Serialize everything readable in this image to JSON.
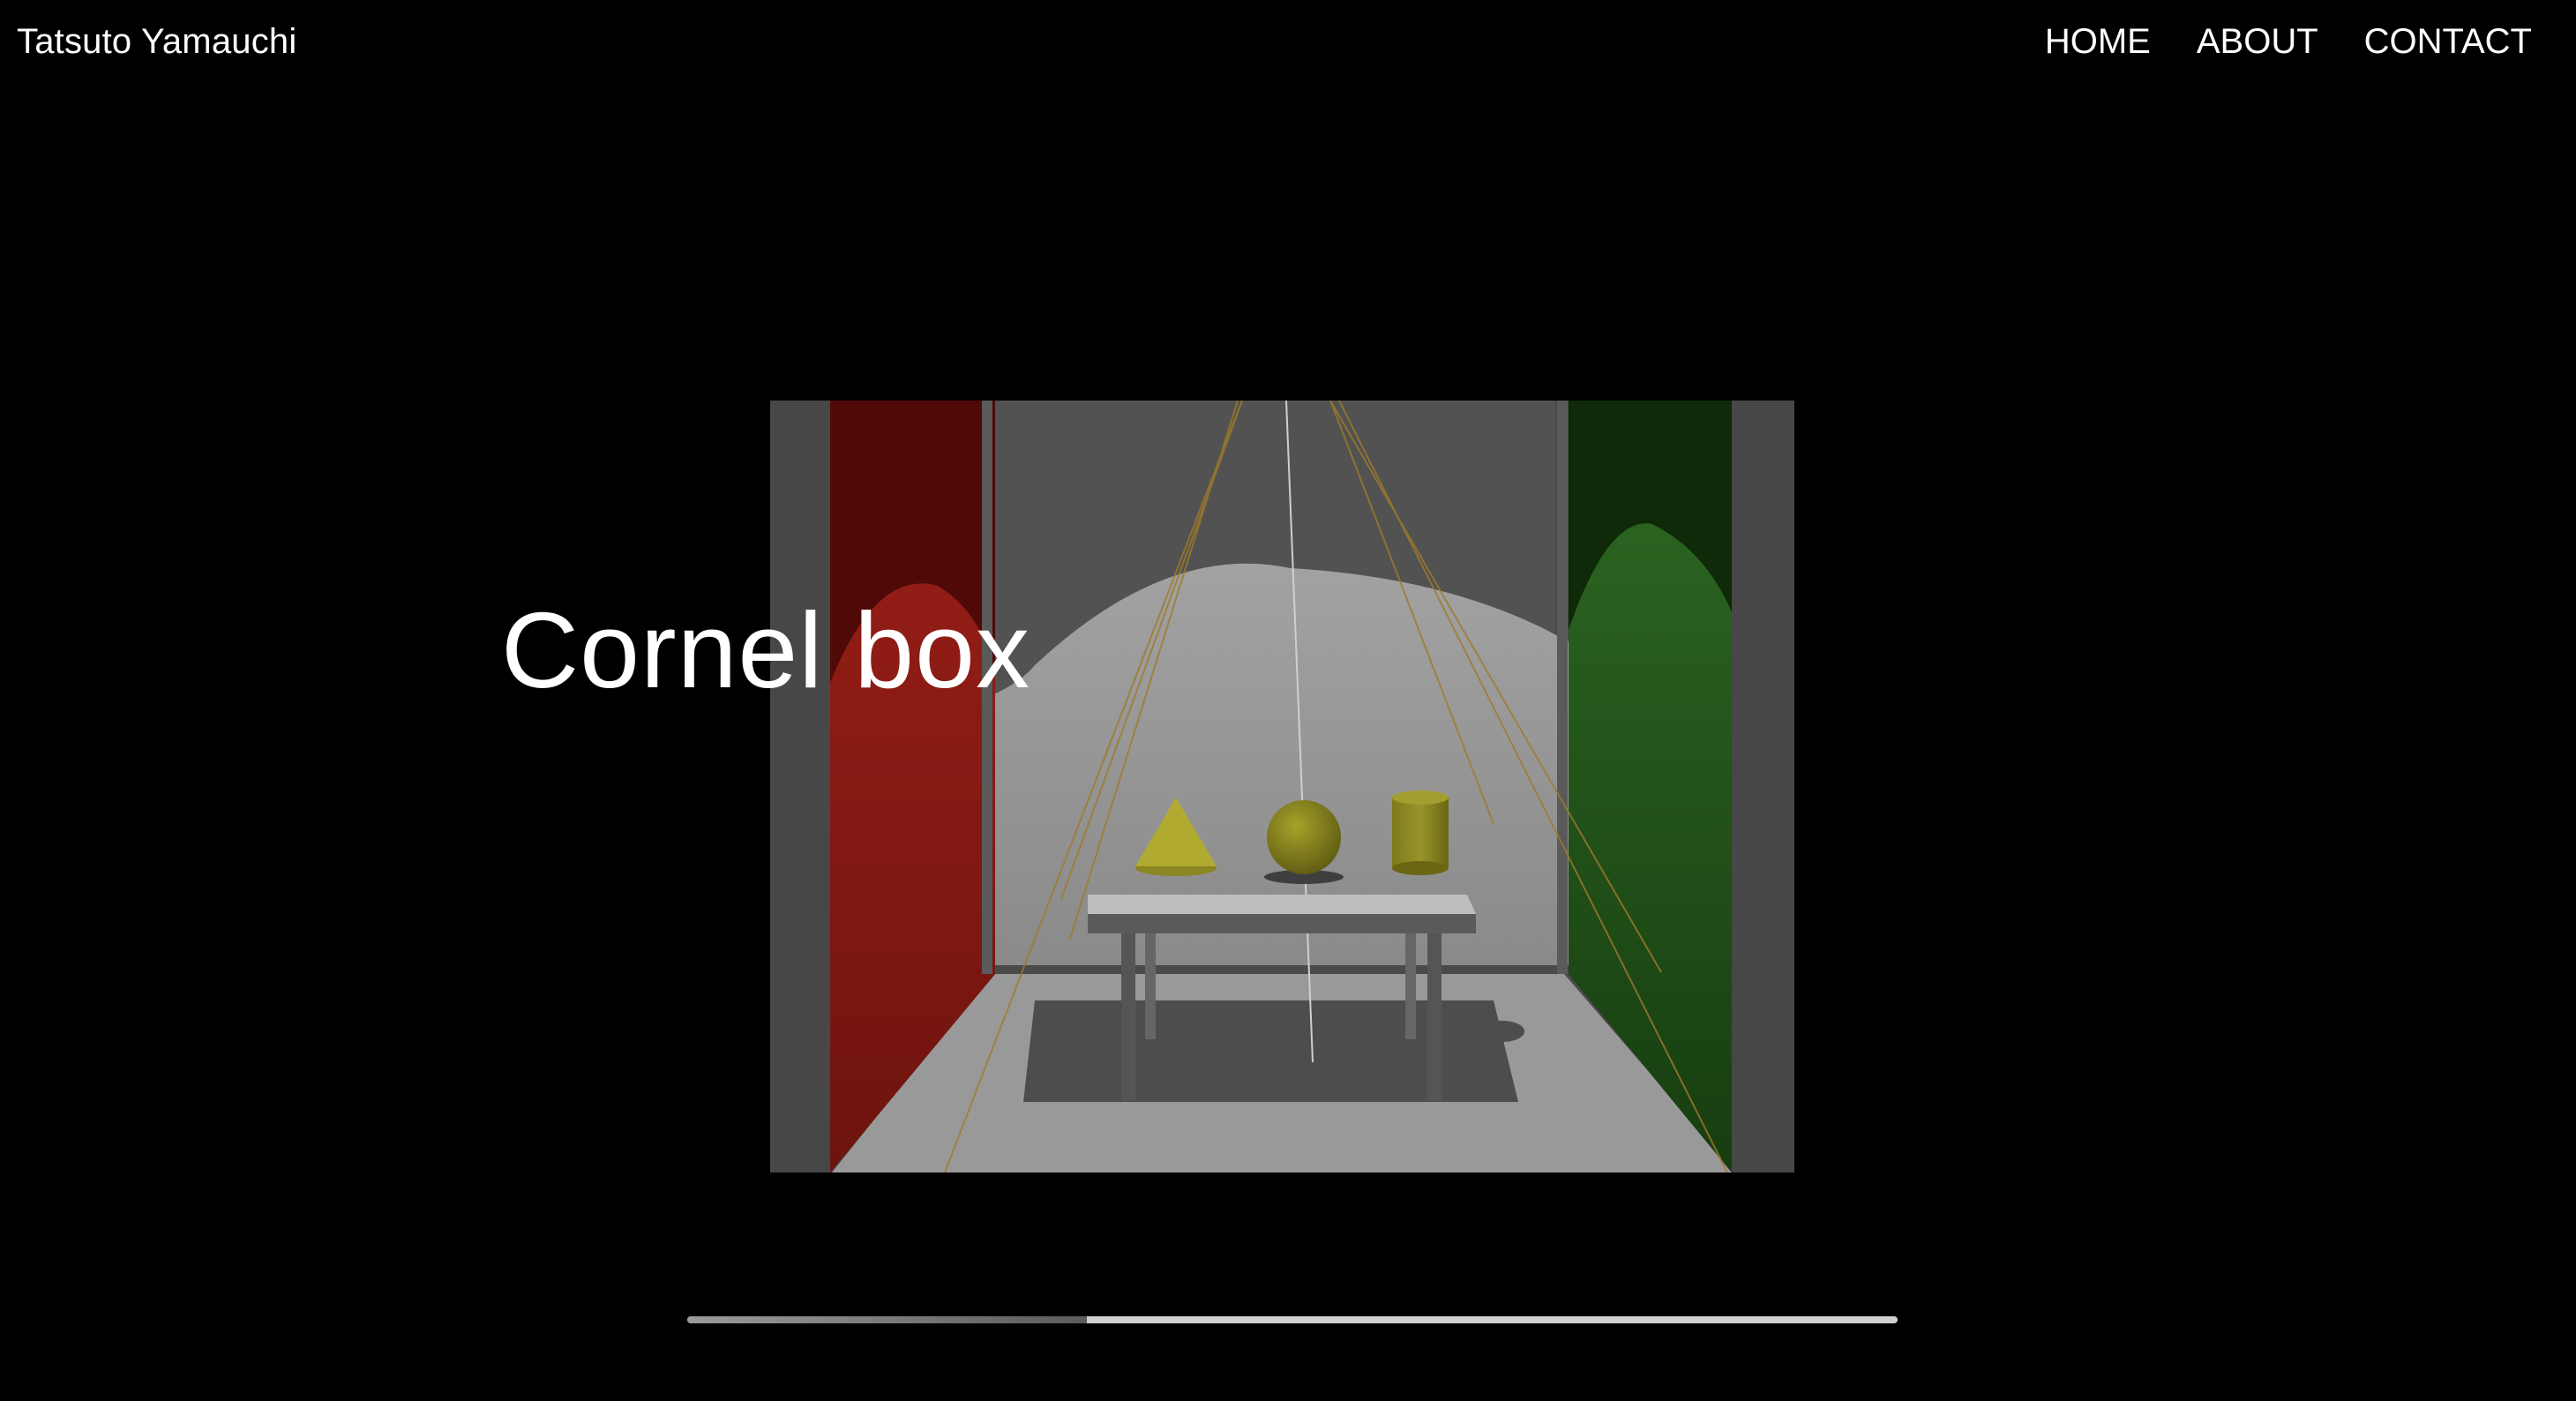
{
  "header": {
    "site_name": "Tatsuto Yamauchi",
    "nav": [
      {
        "label": "HOME"
      },
      {
        "label": "ABOUT"
      },
      {
        "label": "CONTACT"
      }
    ]
  },
  "slide": {
    "title": "Cornel box"
  },
  "progress": {
    "fraction": 0.33
  },
  "colors": {
    "background": "#000000",
    "text": "#ffffff",
    "red_wall": "#7a1410",
    "green_wall": "#1e4a14",
    "objects": "#8f8a1e"
  }
}
